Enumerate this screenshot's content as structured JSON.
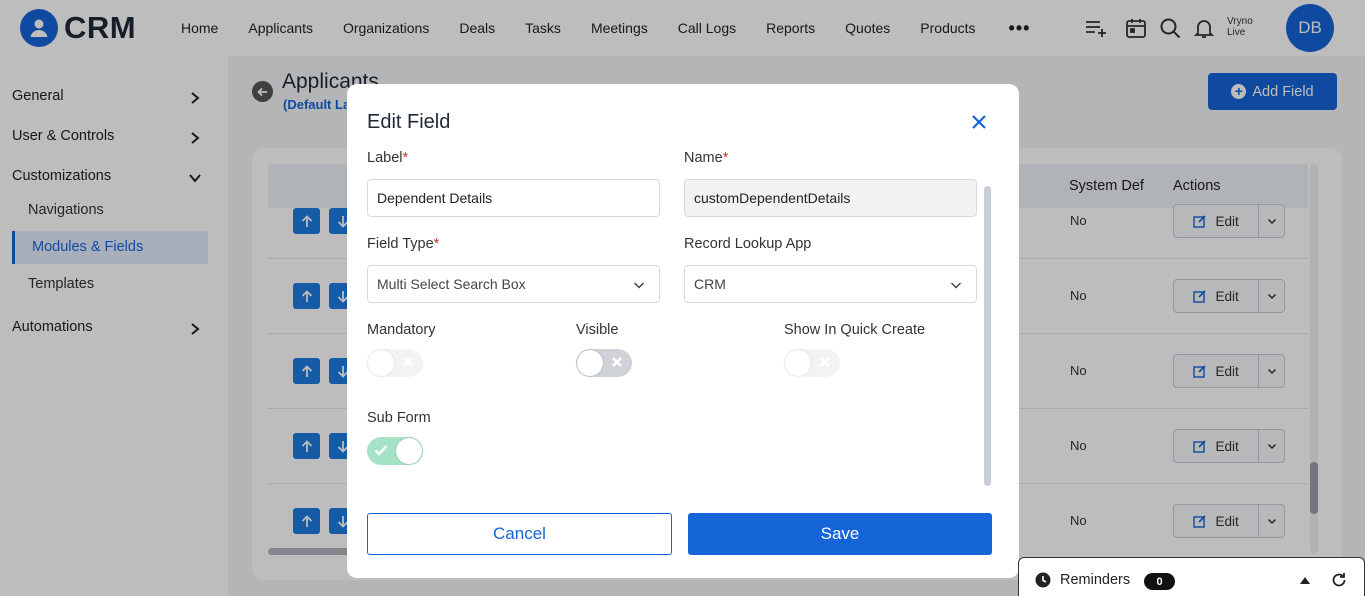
{
  "app": {
    "logo_text": "CRM"
  },
  "nav": {
    "items": [
      "Home",
      "Applicants",
      "Organizations",
      "Deals",
      "Tasks",
      "Meetings",
      "Call Logs",
      "Reports",
      "Quotes",
      "Products"
    ],
    "more": "•••",
    "user_line1": "Vryno",
    "user_line2": "Live",
    "avatar_initials": "DB"
  },
  "sidebar": {
    "general": "General",
    "user_controls": "User & Controls",
    "customizations": "Customizations",
    "navigations": "Navigations",
    "modules_fields": "Modules & Fields",
    "templates": "Templates",
    "automations": "Automations"
  },
  "main": {
    "title": "Applicants",
    "subtitle": "(Default La",
    "add_field_label": "Add Field",
    "columns": {
      "system_def": "System Def",
      "actions": "Actions"
    },
    "rows": [
      {
        "system_def": "No",
        "action": "Edit"
      },
      {
        "system_def": "No",
        "action": "Edit"
      },
      {
        "system_def": "No",
        "action": "Edit"
      },
      {
        "system_def": "No",
        "action": "Edit"
      },
      {
        "system_def": "No",
        "action": "Edit"
      }
    ]
  },
  "modal": {
    "title": "Edit Field",
    "label_label": "Label",
    "label_value": "Dependent Details",
    "name_label": "Name",
    "name_value": "customDependentDetails",
    "field_type_label": "Field Type",
    "field_type_value": "Multi Select Search Box",
    "record_lookup_label": "Record Lookup App",
    "record_lookup_value": "CRM",
    "mandatory_label": "Mandatory",
    "mandatory_on": false,
    "visible_label": "Visible",
    "visible_on": false,
    "quick_create_label": "Show In Quick Create",
    "quick_create_on": false,
    "sub_form_label": "Sub Form",
    "sub_form_on": true,
    "required_marker": "*",
    "cancel_label": "Cancel",
    "save_label": "Save"
  },
  "reminders": {
    "label": "Reminders",
    "count": "0"
  },
  "colors": {
    "accent": "#1565d8",
    "toggle_on": "#a6e3c6",
    "required": "#c0392b"
  }
}
